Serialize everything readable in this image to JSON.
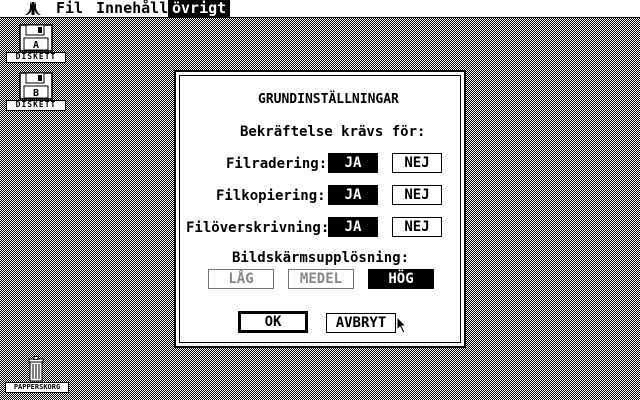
{
  "menu": {
    "atari": "atari-logo",
    "items": [
      "Fil",
      "Innehåll",
      "övrigt"
    ],
    "selected_index": 2
  },
  "desktop": {
    "disk_a_label": "DISKETT",
    "disk_b_label": "DISKETT",
    "trash_label": "PAPPERSKORG"
  },
  "dialog": {
    "title": "GRUNDINSTÄLLNINGAR",
    "subtitle": "Bekräftelse krävs för:",
    "rows": [
      {
        "label": "Filradering:",
        "yes": "JA",
        "no": "NEJ",
        "selected": "yes"
      },
      {
        "label": "Filkopiering:",
        "yes": "JA",
        "no": "NEJ",
        "selected": "yes"
      },
      {
        "label": "Filöverskrivning:",
        "yes": "JA",
        "no": "NEJ",
        "selected": "yes"
      }
    ],
    "resolution_label": "Bildskärmsupplösning:",
    "resolutions": [
      {
        "label": "LÅG",
        "state": "disabled"
      },
      {
        "label": "MEDEL",
        "state": "disabled"
      },
      {
        "label": "HÖG",
        "state": "selected"
      }
    ],
    "ok": "OK",
    "cancel": "AVBRYT"
  }
}
